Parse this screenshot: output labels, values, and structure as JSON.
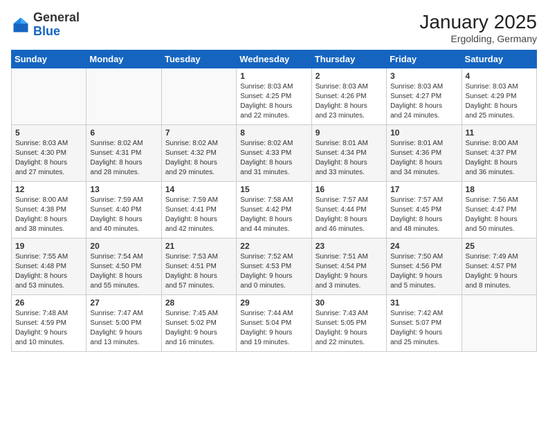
{
  "header": {
    "logo_general": "General",
    "logo_blue": "Blue",
    "title": "January 2025",
    "subtitle": "Ergolding, Germany"
  },
  "calendar": {
    "days_of_week": [
      "Sunday",
      "Monday",
      "Tuesday",
      "Wednesday",
      "Thursday",
      "Friday",
      "Saturday"
    ],
    "weeks": [
      [
        {
          "day": "",
          "info": ""
        },
        {
          "day": "",
          "info": ""
        },
        {
          "day": "",
          "info": ""
        },
        {
          "day": "1",
          "info": "Sunrise: 8:03 AM\nSunset: 4:25 PM\nDaylight: 8 hours\nand 22 minutes."
        },
        {
          "day": "2",
          "info": "Sunrise: 8:03 AM\nSunset: 4:26 PM\nDaylight: 8 hours\nand 23 minutes."
        },
        {
          "day": "3",
          "info": "Sunrise: 8:03 AM\nSunset: 4:27 PM\nDaylight: 8 hours\nand 24 minutes."
        },
        {
          "day": "4",
          "info": "Sunrise: 8:03 AM\nSunset: 4:29 PM\nDaylight: 8 hours\nand 25 minutes."
        }
      ],
      [
        {
          "day": "5",
          "info": "Sunrise: 8:03 AM\nSunset: 4:30 PM\nDaylight: 8 hours\nand 27 minutes."
        },
        {
          "day": "6",
          "info": "Sunrise: 8:02 AM\nSunset: 4:31 PM\nDaylight: 8 hours\nand 28 minutes."
        },
        {
          "day": "7",
          "info": "Sunrise: 8:02 AM\nSunset: 4:32 PM\nDaylight: 8 hours\nand 29 minutes."
        },
        {
          "day": "8",
          "info": "Sunrise: 8:02 AM\nSunset: 4:33 PM\nDaylight: 8 hours\nand 31 minutes."
        },
        {
          "day": "9",
          "info": "Sunrise: 8:01 AM\nSunset: 4:34 PM\nDaylight: 8 hours\nand 33 minutes."
        },
        {
          "day": "10",
          "info": "Sunrise: 8:01 AM\nSunset: 4:36 PM\nDaylight: 8 hours\nand 34 minutes."
        },
        {
          "day": "11",
          "info": "Sunrise: 8:00 AM\nSunset: 4:37 PM\nDaylight: 8 hours\nand 36 minutes."
        }
      ],
      [
        {
          "day": "12",
          "info": "Sunrise: 8:00 AM\nSunset: 4:38 PM\nDaylight: 8 hours\nand 38 minutes."
        },
        {
          "day": "13",
          "info": "Sunrise: 7:59 AM\nSunset: 4:40 PM\nDaylight: 8 hours\nand 40 minutes."
        },
        {
          "day": "14",
          "info": "Sunrise: 7:59 AM\nSunset: 4:41 PM\nDaylight: 8 hours\nand 42 minutes."
        },
        {
          "day": "15",
          "info": "Sunrise: 7:58 AM\nSunset: 4:42 PM\nDaylight: 8 hours\nand 44 minutes."
        },
        {
          "day": "16",
          "info": "Sunrise: 7:57 AM\nSunset: 4:44 PM\nDaylight: 8 hours\nand 46 minutes."
        },
        {
          "day": "17",
          "info": "Sunrise: 7:57 AM\nSunset: 4:45 PM\nDaylight: 8 hours\nand 48 minutes."
        },
        {
          "day": "18",
          "info": "Sunrise: 7:56 AM\nSunset: 4:47 PM\nDaylight: 8 hours\nand 50 minutes."
        }
      ],
      [
        {
          "day": "19",
          "info": "Sunrise: 7:55 AM\nSunset: 4:48 PM\nDaylight: 8 hours\nand 53 minutes."
        },
        {
          "day": "20",
          "info": "Sunrise: 7:54 AM\nSunset: 4:50 PM\nDaylight: 8 hours\nand 55 minutes."
        },
        {
          "day": "21",
          "info": "Sunrise: 7:53 AM\nSunset: 4:51 PM\nDaylight: 8 hours\nand 57 minutes."
        },
        {
          "day": "22",
          "info": "Sunrise: 7:52 AM\nSunset: 4:53 PM\nDaylight: 9 hours\nand 0 minutes."
        },
        {
          "day": "23",
          "info": "Sunrise: 7:51 AM\nSunset: 4:54 PM\nDaylight: 9 hours\nand 3 minutes."
        },
        {
          "day": "24",
          "info": "Sunrise: 7:50 AM\nSunset: 4:56 PM\nDaylight: 9 hours\nand 5 minutes."
        },
        {
          "day": "25",
          "info": "Sunrise: 7:49 AM\nSunset: 4:57 PM\nDaylight: 9 hours\nand 8 minutes."
        }
      ],
      [
        {
          "day": "26",
          "info": "Sunrise: 7:48 AM\nSunset: 4:59 PM\nDaylight: 9 hours\nand 10 minutes."
        },
        {
          "day": "27",
          "info": "Sunrise: 7:47 AM\nSunset: 5:00 PM\nDaylight: 9 hours\nand 13 minutes."
        },
        {
          "day": "28",
          "info": "Sunrise: 7:45 AM\nSunset: 5:02 PM\nDaylight: 9 hours\nand 16 minutes."
        },
        {
          "day": "29",
          "info": "Sunrise: 7:44 AM\nSunset: 5:04 PM\nDaylight: 9 hours\nand 19 minutes."
        },
        {
          "day": "30",
          "info": "Sunrise: 7:43 AM\nSunset: 5:05 PM\nDaylight: 9 hours\nand 22 minutes."
        },
        {
          "day": "31",
          "info": "Sunrise: 7:42 AM\nSunset: 5:07 PM\nDaylight: 9 hours\nand 25 minutes."
        },
        {
          "day": "",
          "info": ""
        }
      ]
    ]
  }
}
